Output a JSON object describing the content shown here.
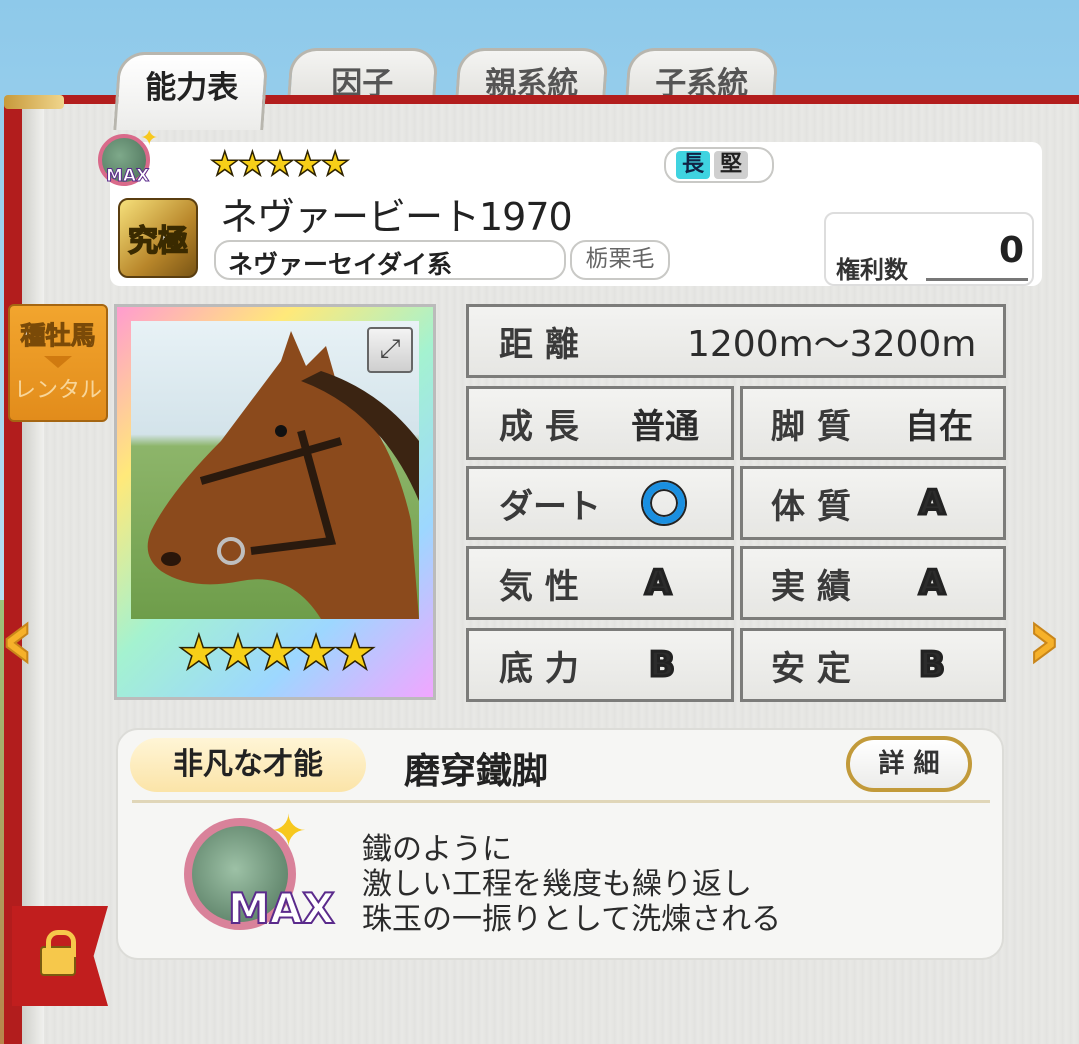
{
  "tabs": [
    {
      "label": "能力表",
      "active": true
    },
    {
      "label": "因子"
    },
    {
      "label": "親系統"
    },
    {
      "label": "子系統"
    }
  ],
  "horse": {
    "max_badge": "MAX",
    "rank_badge": "究極",
    "stars": "★★★★★",
    "name": "ネヴァービート1970",
    "lineage": "ネヴァーセイダイ系",
    "coat": "栃栗毛",
    "traits": [
      "長",
      "堅"
    ],
    "rights_label": "権利数",
    "rights_value": "0"
  },
  "side_tag": {
    "line1": "種牡馬",
    "line2": "レンタル"
  },
  "portrait": {
    "stars": "★★★★★"
  },
  "stats": {
    "distance": {
      "label": "距 離",
      "value": "1200m〜3200m"
    },
    "growth": {
      "label": "成 長",
      "value": "普通"
    },
    "style": {
      "label": "脚 質",
      "value": "自在"
    },
    "dirt": {
      "label": "ダート",
      "grade": "O"
    },
    "constitution": {
      "label": "体 質",
      "grade": "A"
    },
    "temperament": {
      "label": "気 性",
      "grade": "A"
    },
    "record": {
      "label": "実 績",
      "grade": "A"
    },
    "stamina": {
      "label": "底 力",
      "grade": "B"
    },
    "stability": {
      "label": "安 定",
      "grade": "B"
    }
  },
  "talent": {
    "section_label": "非凡な才能",
    "name": "磨穿鐵脚",
    "detail_button": "詳 細",
    "badge": "MAX",
    "description": [
      "鐵のように",
      "激しい工程を幾度も繰り返し",
      "珠玉の一振りとして洗煉される"
    ]
  },
  "colors": {
    "book_red": "#b21d1d",
    "gold": "#e8b63a",
    "grade_a": "#e02424",
    "grade_b": "#1a8fe0"
  }
}
